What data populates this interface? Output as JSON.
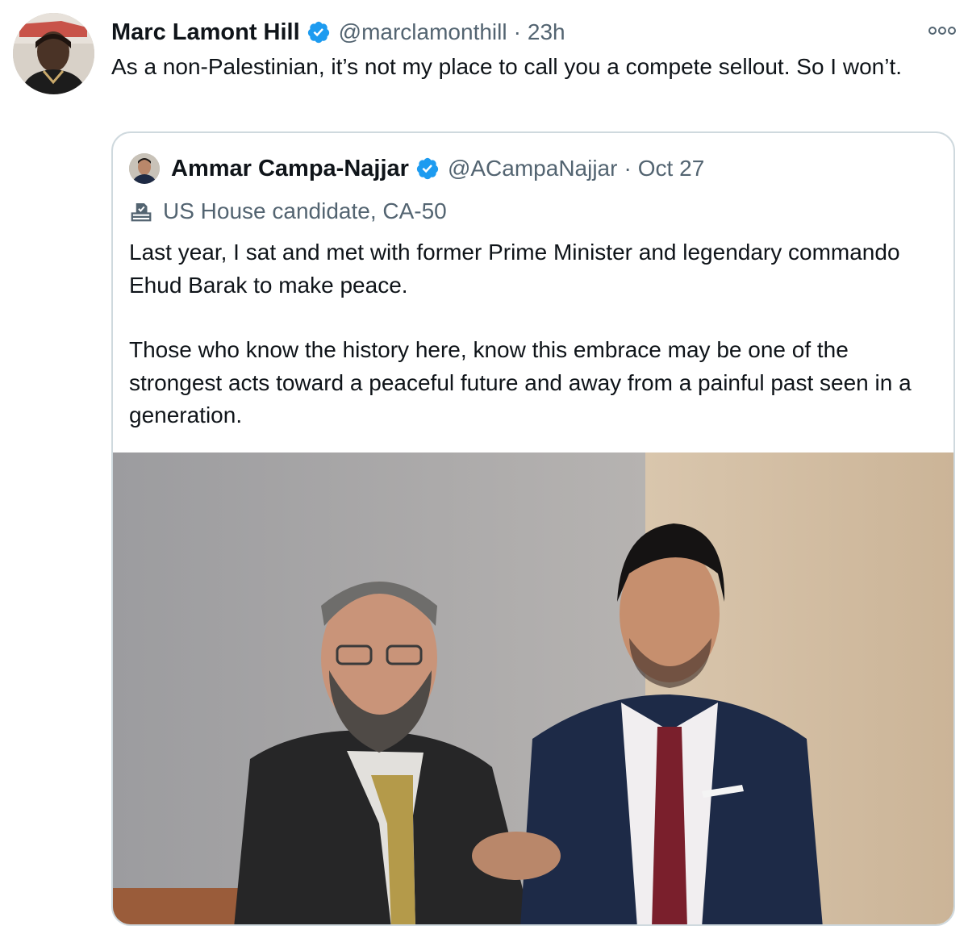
{
  "tweet": {
    "author_name": "Marc Lamont Hill",
    "handle": "@marclamonthill",
    "separator": "·",
    "time": "23h",
    "text": "As a non-Palestinian, it’s not my place to call you a compete sellout. So I won’t.",
    "avatar_icon": "user-avatar",
    "verified_icon": "verified-badge-icon",
    "more_icon": "more-options-icon"
  },
  "quote": {
    "author_name": "Ammar Campa-Najjar",
    "handle": "@ACampaNajjar",
    "separator": "·",
    "time": "Oct 27",
    "label": "US House candidate, CA-50",
    "label_icon": "ballot-box-icon",
    "paragraphs": [
      "Last year, I sat and met with former Prime Minister and legendary commando Ehud Barak to make peace.",
      "Those who know the history here, know this embrace may be one of the strongest acts toward a peaceful future and away from a painful past seen in a generation."
    ],
    "photo_icon": "photo-two-men-shaking-hands"
  },
  "colors": {
    "verified_blue": "#1d9bf0",
    "secondary_text": "#536471",
    "border": "#cfd9de"
  }
}
